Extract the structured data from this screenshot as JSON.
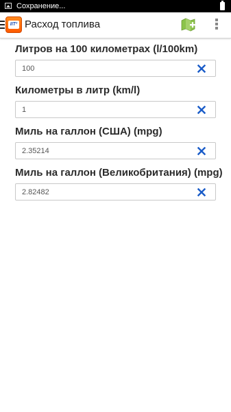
{
  "status_bar": {
    "text": "Сохранение...",
    "icons": [
      "gallery-icon",
      "battery-icon"
    ]
  },
  "action_bar": {
    "title": "Расход топлива",
    "logo_text": "IIT²",
    "icons": [
      "menu-icon",
      "app-logo",
      "map-icon",
      "overflow-menu-icon"
    ]
  },
  "fields": [
    {
      "label": "Литров на 100 километрах (l/100km)",
      "value": "100"
    },
    {
      "label": "Километры в литр (km/l)",
      "value": "1"
    },
    {
      "label": "Миль на галлон (США) (mpg)",
      "value": "2.35214"
    },
    {
      "label": "Миль на галлон (Великобритания) (mpg)",
      "value": "2.82482"
    }
  ],
  "colors": {
    "status_bar_bg": "#000000",
    "clear_icon": "#1a5cc8",
    "logo_orange": "#ff6a00",
    "map_icon_green": "#8bc34a"
  }
}
